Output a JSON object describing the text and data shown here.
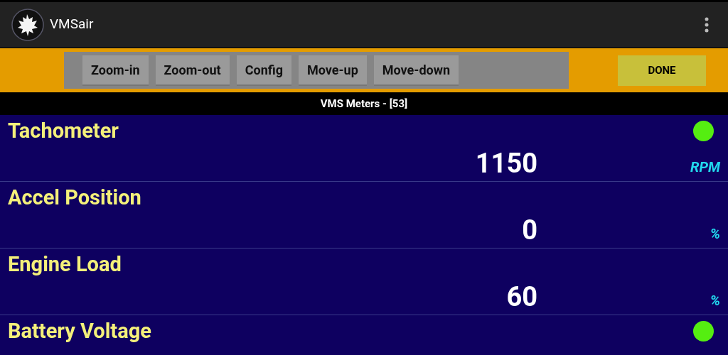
{
  "app_bar": {
    "title": "VMSair"
  },
  "toolbar": {
    "buttons": [
      "Zoom-in",
      "Zoom-out",
      "Config",
      "Move-up",
      "Move-down"
    ],
    "done_button": "DONE"
  },
  "header": {
    "title": "VMS Meters - [53]"
  },
  "meters": [
    {
      "name": "Tachometer",
      "value": "1150",
      "unit": "RPM",
      "color": "#55ee11"
    },
    {
      "name": "Accel Position",
      "value": "0",
      "unit": "%"
    },
    {
      "name": "Engine Load",
      "value": "60",
      "unit": "%"
    },
    {
      "name": "Battery Voltage",
      "color": "#55ee11"
    }
  ]
}
